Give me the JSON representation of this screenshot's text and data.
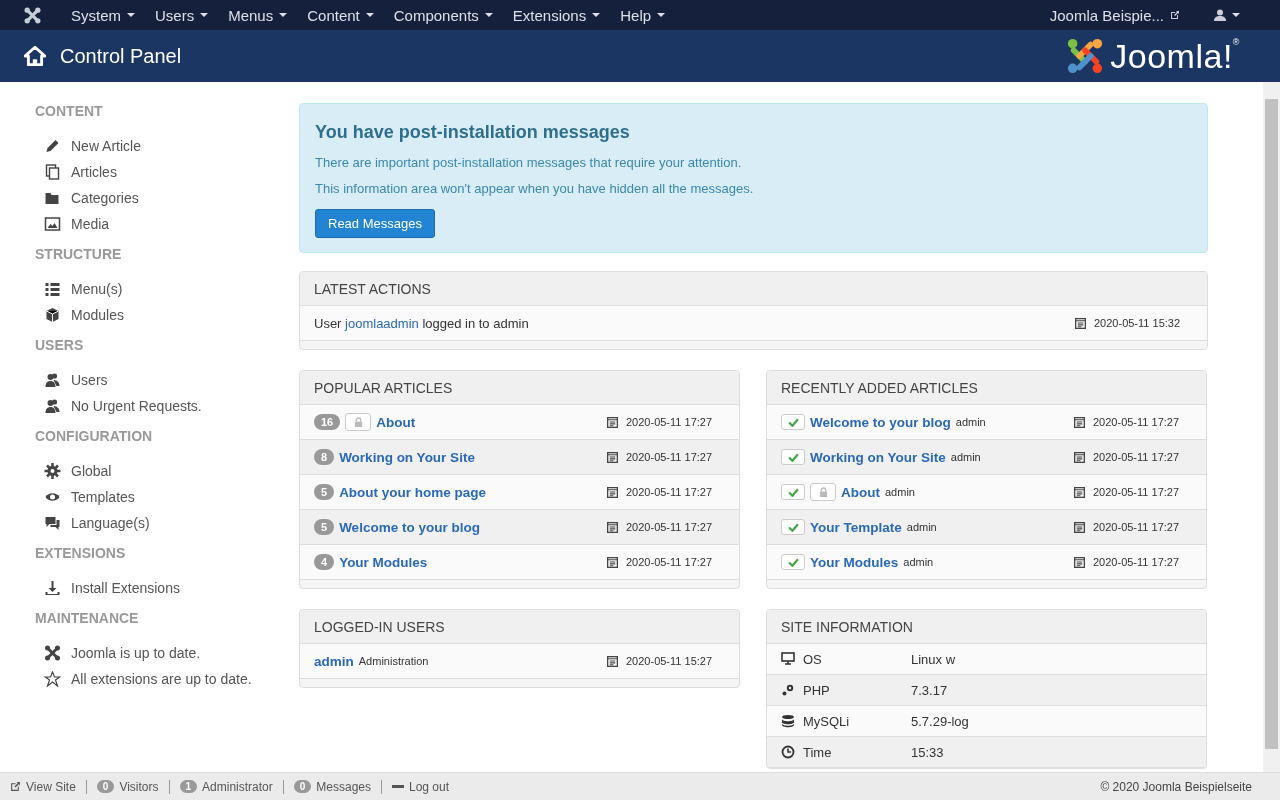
{
  "topnav": {
    "menus": [
      "System",
      "Users",
      "Menus",
      "Content",
      "Components",
      "Extensions",
      "Help"
    ],
    "site_link": "Joomla Beispie..."
  },
  "header": {
    "title": "Control Panel",
    "logo_text": "Joomla!",
    "logo_mark": "®"
  },
  "sidebar": [
    {
      "heading": "CONTENT",
      "items": [
        "New Article",
        "Articles",
        "Categories",
        "Media"
      ]
    },
    {
      "heading": "STRUCTURE",
      "items": [
        "Menu(s)",
        "Modules"
      ]
    },
    {
      "heading": "USERS",
      "items": [
        "Users",
        "No Urgent Requests."
      ]
    },
    {
      "heading": "CONFIGURATION",
      "items": [
        "Global",
        "Templates",
        "Language(s)"
      ]
    },
    {
      "heading": "EXTENSIONS",
      "items": [
        "Install Extensions"
      ]
    },
    {
      "heading": "MAINTENANCE",
      "items": [
        "Joomla is up to date.",
        "All extensions are up to date."
      ]
    }
  ],
  "alert": {
    "title": "You have post-installation messages",
    "lines": [
      "There are important post-installation messages that require your attention.",
      "This information area won't appear when you have hidden all the messages."
    ],
    "button": "Read Messages"
  },
  "latest_actions": {
    "title": "LATEST ACTIONS",
    "rows": [
      {
        "before": "User",
        "user": "joomlaadmin",
        "after": "logged in to admin",
        "date": "2020-05-11 15:32"
      }
    ]
  },
  "popular_articles": {
    "title": "POPULAR ARTICLES",
    "rows": [
      {
        "hits": "16",
        "locked": true,
        "title": "About",
        "date": "2020-05-11 17:27"
      },
      {
        "hits": "8",
        "locked": false,
        "title": "Working on Your Site",
        "date": "2020-05-11 17:27"
      },
      {
        "hits": "5",
        "locked": false,
        "title": "About your home page",
        "date": "2020-05-11 17:27"
      },
      {
        "hits": "5",
        "locked": false,
        "title": "Welcome to your blog",
        "date": "2020-05-11 17:27"
      },
      {
        "hits": "4",
        "locked": false,
        "title": "Your Modules",
        "date": "2020-05-11 17:27"
      }
    ]
  },
  "recent_articles": {
    "title": "RECENTLY ADDED ARTICLES",
    "rows": [
      {
        "published": true,
        "locked": false,
        "title": "Welcome to your blog",
        "author": "admin",
        "date": "2020-05-11 17:27"
      },
      {
        "published": true,
        "locked": false,
        "title": "Working on Your Site",
        "author": "admin",
        "date": "2020-05-11 17:27"
      },
      {
        "published": true,
        "locked": true,
        "title": "About",
        "author": "admin",
        "date": "2020-05-11 17:27"
      },
      {
        "published": true,
        "locked": false,
        "title": "Your Template",
        "author": "admin",
        "date": "2020-05-11 17:27"
      },
      {
        "published": true,
        "locked": false,
        "title": "Your Modules",
        "author": "admin",
        "date": "2020-05-11 17:27"
      }
    ]
  },
  "logged_in_users": {
    "title": "LOGGED-IN USERS",
    "rows": [
      {
        "name": "admin",
        "area": "Administration",
        "date": "2020-05-11 15:27"
      }
    ]
  },
  "site_information": {
    "title": "SITE INFORMATION",
    "rows": [
      {
        "label": "OS",
        "value": "Linux w"
      },
      {
        "label": "PHP",
        "value": "7.3.17"
      },
      {
        "label": "MySQLi",
        "value": "5.7.29-log"
      },
      {
        "label": "Time",
        "value": "15:33"
      }
    ]
  },
  "status_bar": {
    "view_site": "View Site",
    "counters": [
      {
        "count": "0",
        "label": "Visitors"
      },
      {
        "count": "1",
        "label": "Administrator"
      },
      {
        "count": "0",
        "label": "Messages"
      }
    ],
    "logout": "Log out",
    "copyright": "© 2020 Joomla Beispielseite"
  }
}
